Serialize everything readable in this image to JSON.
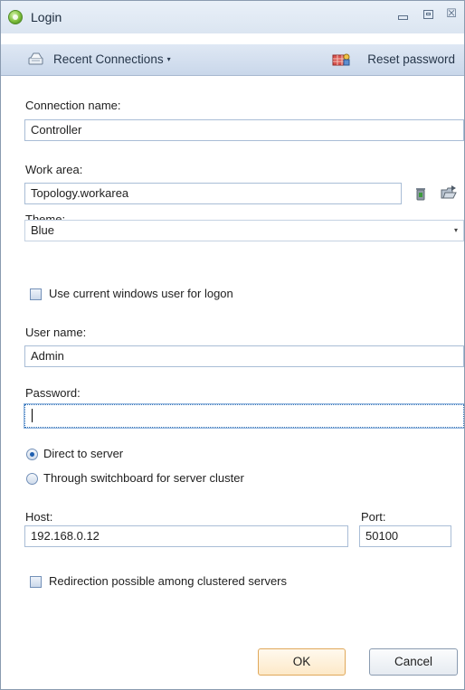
{
  "window": {
    "title": "Login",
    "minimize_glyph": "",
    "maximize_glyph": "",
    "close_glyph": "☒"
  },
  "toolbar": {
    "recent_label": "Recent Connections",
    "recent_caret": "▾",
    "reset_label": "Reset password"
  },
  "form": {
    "connection_name_label": "Connection name:",
    "connection_name_value": "Controller",
    "work_area_label": "Work area:",
    "work_area_value": "Topology.workarea",
    "theme_label": "Theme:",
    "theme_value": "Blue",
    "theme_caret": "▾",
    "use_windows_user_label": "Use current windows user for logon",
    "use_windows_user_checked": false,
    "user_name_label": "User name:",
    "user_name_value": "Admin",
    "password_label": "Password:",
    "password_value": "",
    "connection_mode_options": [
      "Direct to server",
      "Through switchboard for server cluster"
    ],
    "connection_mode_selected": "Direct to server",
    "host_label": "Host:",
    "host_value": "192.168.0.12",
    "port_label": "Port:",
    "port_value": "50100",
    "redirection_label": "Redirection possible among clustered servers",
    "redirection_checked": false
  },
  "buttons": {
    "ok": "OK",
    "cancel": "Cancel"
  },
  "icons": {
    "app": "app-globe-icon",
    "recent_connections": "connections-icon",
    "reset_password": "reset-password-icon",
    "work_area_delete": "trash-icon",
    "work_area_open": "open-folder-icon"
  }
}
